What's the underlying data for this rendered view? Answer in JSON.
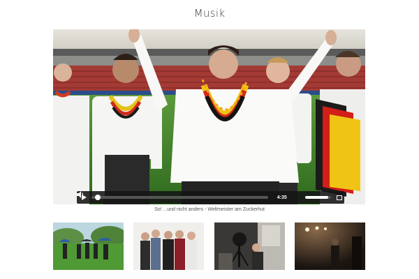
{
  "page": {
    "title": "Musik"
  },
  "video": {
    "caption": "So! ...und nicht anders - Weltmeister am Zuckerhut",
    "time": "4:35",
    "progress": 0.02,
    "volume": 0.9
  },
  "thumbnails": [
    {
      "scene": "outdoor-group-umbrellas"
    },
    {
      "scene": "band-group-portrait"
    },
    {
      "scene": "studio-recording-session"
    },
    {
      "scene": "stage-spotlight-performance"
    }
  ]
}
